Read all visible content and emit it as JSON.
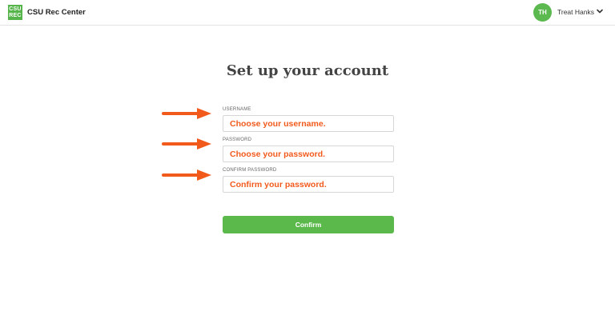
{
  "header": {
    "logo_line1": "CSU",
    "logo_line2": "REC",
    "app_title": "CSU Rec Center",
    "user_initials": "TH",
    "user_name": "Treat Hanks"
  },
  "main": {
    "title": "Set up your account",
    "fields": [
      {
        "label": "USERNAME",
        "placeholder": "Choose your username."
      },
      {
        "label": "PASSWORD",
        "placeholder": "Choose your password."
      },
      {
        "label": "CONFIRM PASSWORD",
        "placeholder": "Confirm your password."
      }
    ],
    "confirm_label": "Confirm"
  },
  "colors": {
    "brand_green": "#5bb94c",
    "annotation_orange": "#f25a1c"
  },
  "icons": {
    "menu_toggle": "chevron-down-icon",
    "annotation": "arrow-right-icon"
  }
}
